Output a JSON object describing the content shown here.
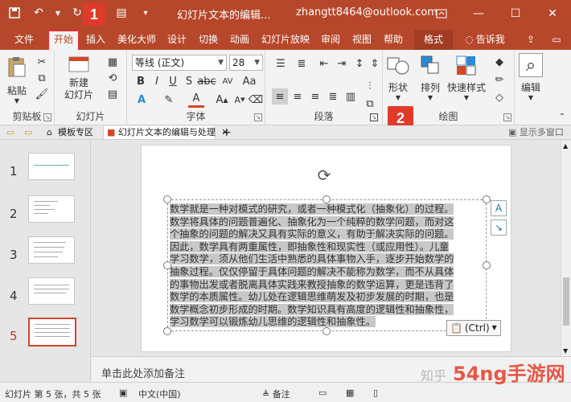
{
  "titlebar": {
    "doc_title": "幻灯片文本的编辑...",
    "account": "zhangtt8464@outlook.com",
    "step1": "1"
  },
  "tabs": [
    "文件",
    "开始",
    "插入",
    "美化大师",
    "设计",
    "切换",
    "动画",
    "幻灯片放映",
    "审阅",
    "视图",
    "帮助",
    "格式"
  ],
  "tell_me": "告诉我",
  "ribbon": {
    "clipboard": {
      "paste": "粘贴",
      "group": "剪贴板"
    },
    "slides": {
      "new_slide": "新建\n幻灯片",
      "group": "幻灯片"
    },
    "font": {
      "font_name": "等线 (正文)",
      "font_size": "28",
      "group": "字体"
    },
    "paragraph": {
      "group": "段落"
    },
    "drawing": {
      "shapes": "形状",
      "arrange": "排列",
      "quick_styles": "快速样式",
      "group": "绘图"
    },
    "editing": {
      "edit": "编辑"
    },
    "step2": "2"
  },
  "docbar": {
    "template": "模板专区",
    "doc_tab": "幻灯片文本的编辑与处理",
    "multi_window": "显示多窗口"
  },
  "thumbnails": [
    {
      "num": "1"
    },
    {
      "num": "2"
    },
    {
      "num": "3"
    },
    {
      "num": "4"
    },
    {
      "num": "5",
      "selected": true
    }
  ],
  "slide_text_lines": [
    "数学就是一种对模式的研究，或者一种模式化（抽象化）的过程。",
    "数学将具体的问题普遍化、抽象化为一个纯粹的数学问题，而对这",
    "个抽象的问题的解决又具有实际的意义，有助于解决实际的问题。",
    "因此，数学具有两重属性，即抽象性和现实性（或应用性）。儿童",
    "学习数学，须从他们生活中熟悉的具体事物入手，逐步开始数学的",
    "抽象过程。仅仅停留于具体问题的解决不能称为数学，而不从具体",
    "的事物出发或者脱离具体实践来教授抽象的数学运算，更是违背了",
    "数学的本质属性。幼儿处在逻辑思维萌发及初步发展的时期，也是",
    "数学概念初步形成的时期。数学知识具有高度的逻辑性和抽象性，",
    "学习数学可以锻炼幼儿思维的逻辑性和抽象性。"
  ],
  "paste_tag": "(Ctrl)",
  "notes_placeholder": "单击此处添加备注",
  "status": {
    "slide_info": "幻灯片 第 5 张，共 5 张",
    "language": "中文(中国)",
    "notes": "备注"
  },
  "watermark": {
    "zhihu": "知乎",
    "brand": "54ng手游网"
  },
  "colors": {
    "accent": "#b7472a",
    "badge": "#e03a2a"
  }
}
